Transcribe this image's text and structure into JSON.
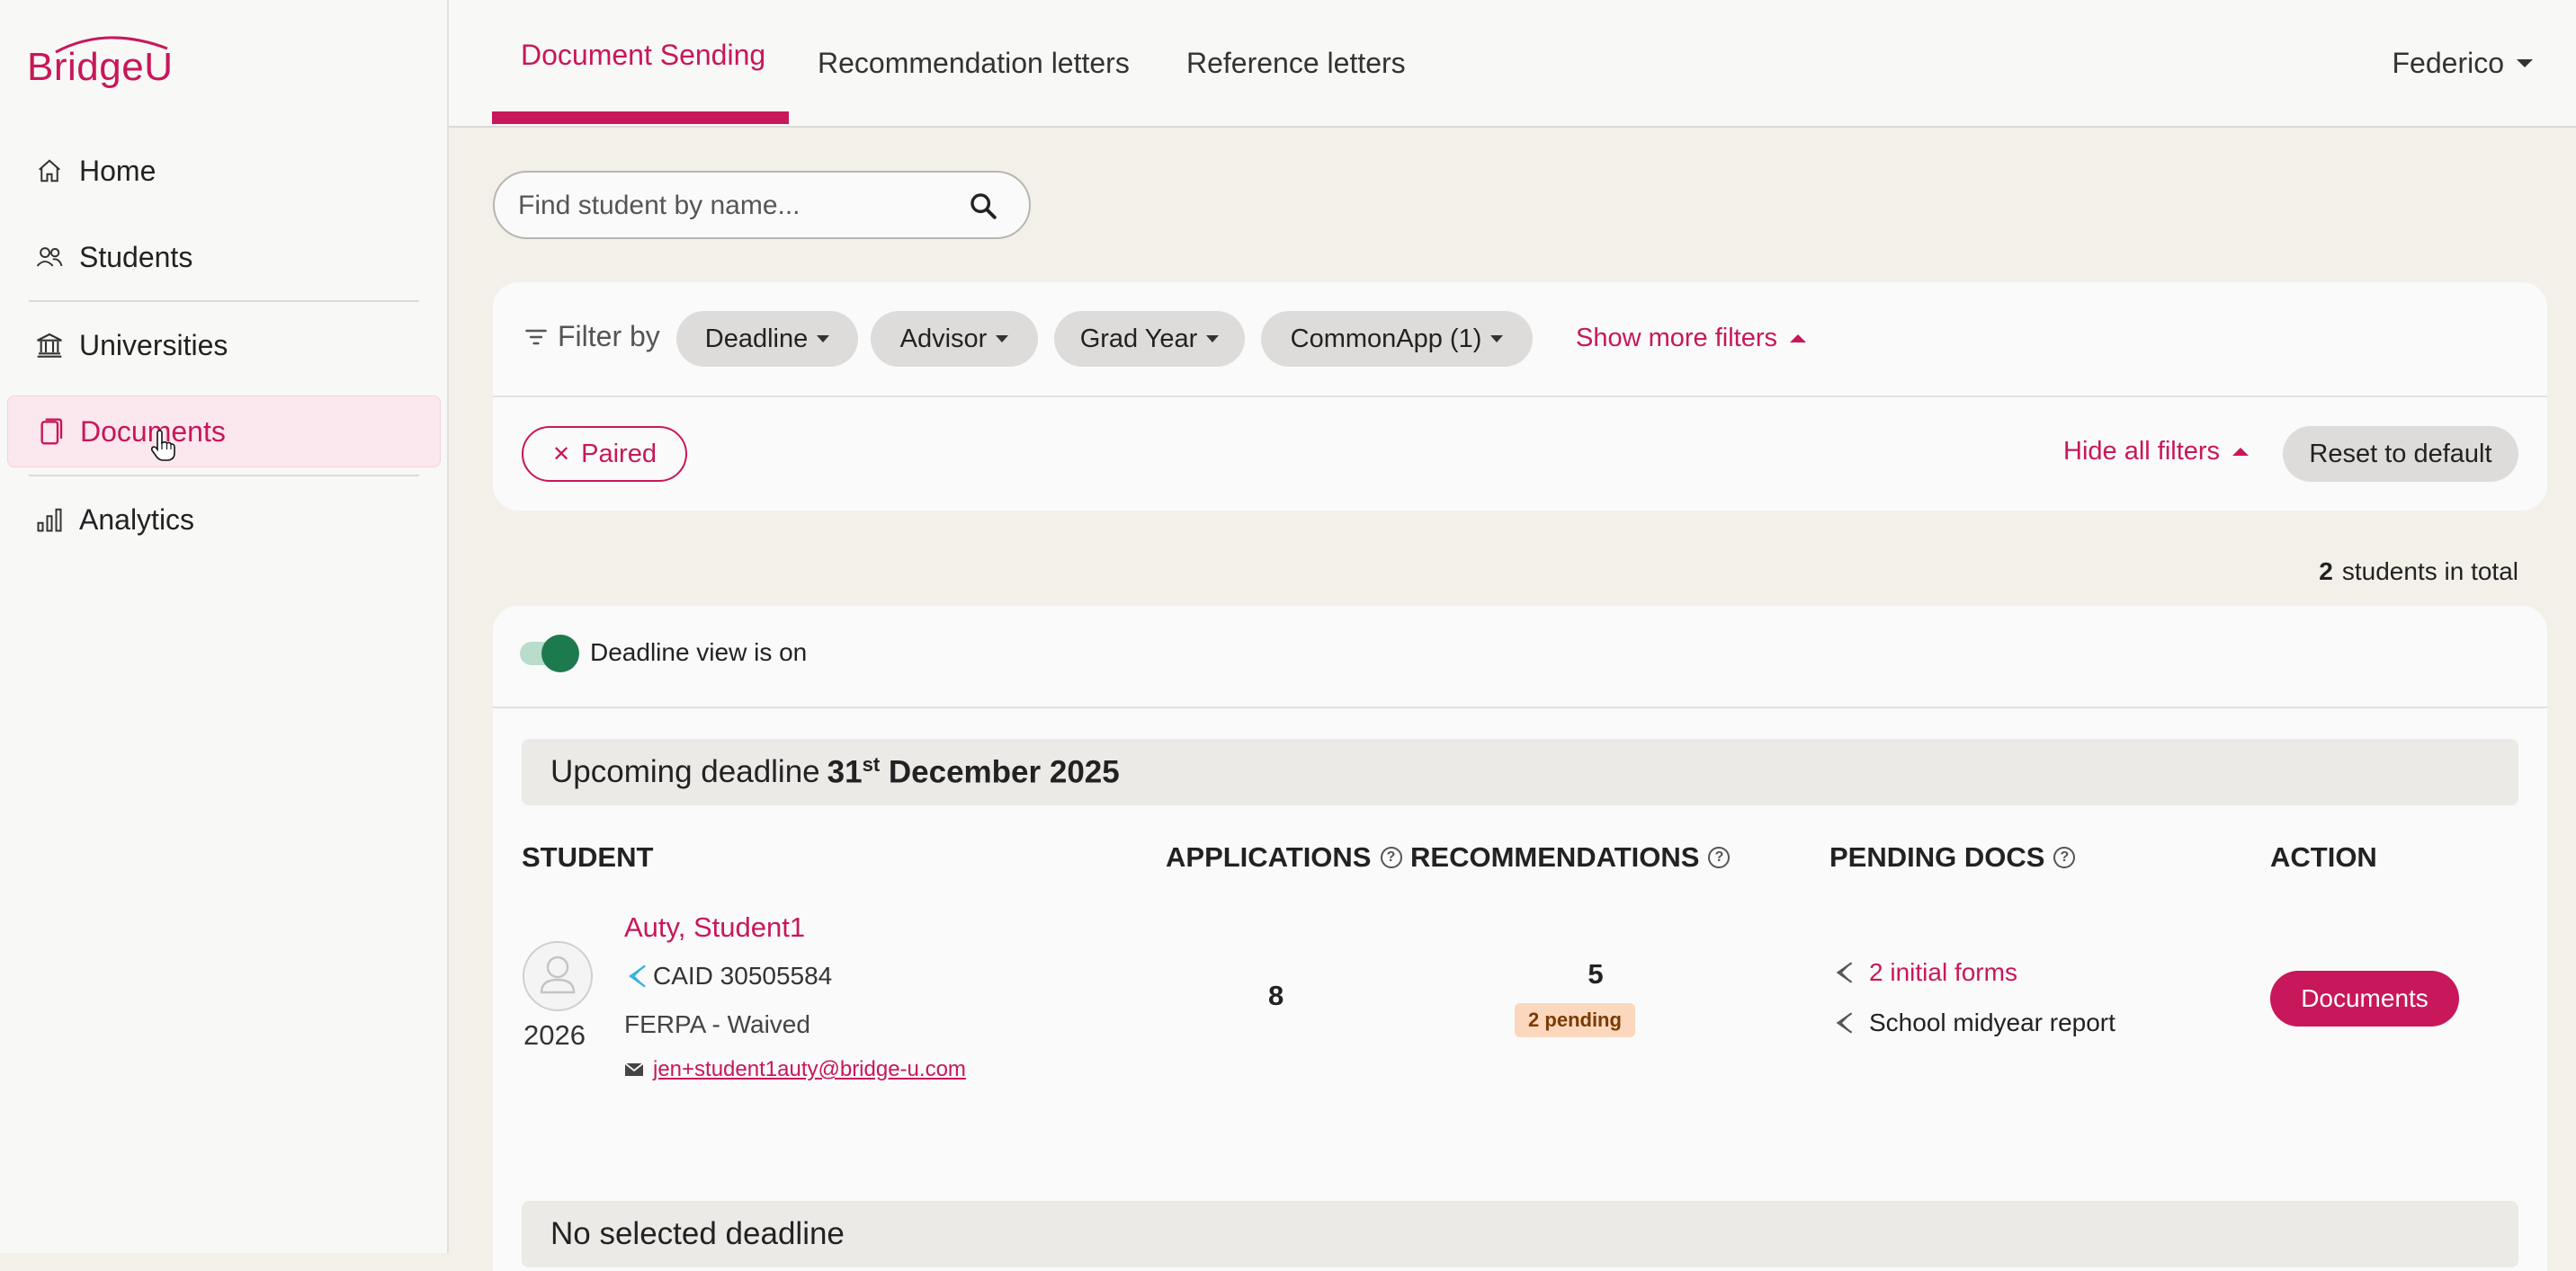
{
  "brand": {
    "name": "BridgeU",
    "color": "#c8175a"
  },
  "sidebar": {
    "items": [
      {
        "label": "Home",
        "icon": "home-icon"
      },
      {
        "label": "Students",
        "icon": "users-icon"
      },
      {
        "label": "Universities",
        "icon": "university-icon"
      },
      {
        "label": "Documents",
        "icon": "document-icon",
        "active": true
      },
      {
        "label": "Analytics",
        "icon": "bar-chart-icon"
      }
    ]
  },
  "tabs": [
    {
      "label": "Document Sending",
      "active": true
    },
    {
      "label": "Recommendation letters"
    },
    {
      "label": "Reference letters"
    }
  ],
  "user": {
    "name": "Federico"
  },
  "search": {
    "placeholder": "Find student by name..."
  },
  "filters": {
    "label": "Filter by",
    "chips": [
      "Deadline",
      "Advisor",
      "Grad Year",
      "CommonApp (1)"
    ],
    "show_more": "Show more filters",
    "active_filter": "Paired",
    "hide_all": "Hide all filters",
    "reset": "Reset to default"
  },
  "summary": {
    "count": "2",
    "label": "students in total"
  },
  "deadline_view": {
    "label": "Deadline view is on",
    "on": true
  },
  "upcoming": {
    "prefix": "Upcoming deadline",
    "day": "31",
    "suffix": "st",
    "rest": "December 2025"
  },
  "columns": {
    "student": "STUDENT",
    "applications": "APPLICATIONS",
    "recommendations": "RECOMMENDATIONS",
    "pending_docs": "PENDING DOCS",
    "action": "ACTION"
  },
  "student": {
    "name": "Auty, Student1",
    "caid": "CAID 30505584",
    "ferpa": "FERPA - Waived",
    "email": "jen+student1auty@bridge-u.com",
    "grad_year": "2026",
    "applications": "8",
    "recommendations": "5",
    "pending_badge": "2 pending",
    "pending_docs": [
      "2 initial forms",
      "School midyear report"
    ],
    "action": "Documents"
  },
  "no_deadline": {
    "label": "No selected deadline"
  }
}
